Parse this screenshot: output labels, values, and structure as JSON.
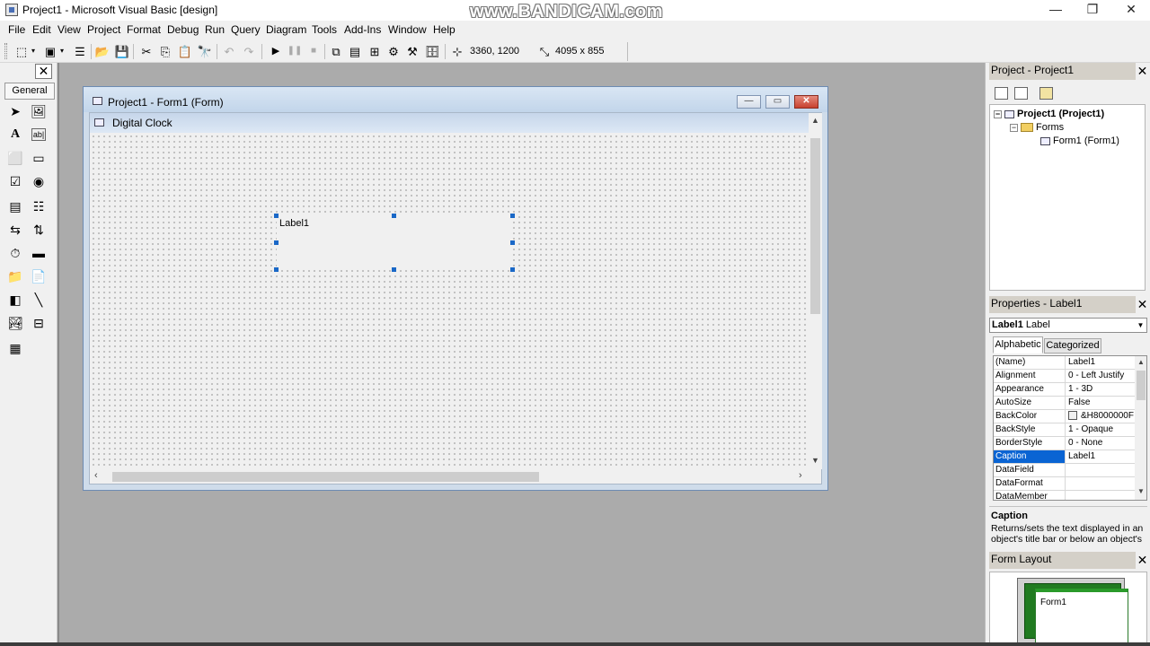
{
  "window": {
    "title": "Project1 - Microsoft Visual Basic [design]",
    "watermark": "www.BANDICAM.com",
    "minimize": "—",
    "maximize": "❐",
    "close": "✕"
  },
  "menu": [
    "File",
    "Edit",
    "View",
    "Project",
    "Format",
    "Debug",
    "Run",
    "Query",
    "Diagram",
    "Tools",
    "Add-Ins",
    "Window",
    "Help"
  ],
  "toolbar": {
    "position": "3360, 1200",
    "size": "4095 x 855"
  },
  "toolbox": {
    "close": "✕",
    "tab": "General"
  },
  "form_window": {
    "title": "Project1 - Form1 (Form)",
    "caption": "Digital Clock",
    "label_caption": "Label1"
  },
  "project_panel": {
    "title": "Project - Project1",
    "close": "✕",
    "tree": {
      "root": "Project1 (Project1)",
      "folder": "Forms",
      "form": "Form1 (Form1)"
    }
  },
  "properties_panel": {
    "title": "Properties - Label1",
    "close": "✕",
    "object_name": "Label1",
    "object_type": "Label",
    "tabs": [
      "Alphabetic",
      "Categorized"
    ],
    "rows": [
      {
        "name": "(Name)",
        "value": "Label1"
      },
      {
        "name": "Alignment",
        "value": "0 - Left Justify"
      },
      {
        "name": "Appearance",
        "value": "1 - 3D"
      },
      {
        "name": "AutoSize",
        "value": "False"
      },
      {
        "name": "BackColor",
        "value": "&H8000000F"
      },
      {
        "name": "BackStyle",
        "value": "1 - Opaque"
      },
      {
        "name": "BorderStyle",
        "value": "0 - None"
      },
      {
        "name": "Caption",
        "value": "Label1"
      },
      {
        "name": "DataField",
        "value": ""
      },
      {
        "name": "DataFormat",
        "value": ""
      },
      {
        "name": "DataMember",
        "value": ""
      }
    ],
    "selected_row": "Caption",
    "desc_title": "Caption",
    "desc_text": "Returns/sets the text displayed in an object's title bar or below an object's"
  },
  "form_layout_panel": {
    "title": "Form Layout",
    "close": "✕",
    "form_label": "Form1"
  },
  "colors": {
    "selection": "#0a64d3",
    "handle": "#1a68c7",
    "mdi_background": "#ababab"
  }
}
